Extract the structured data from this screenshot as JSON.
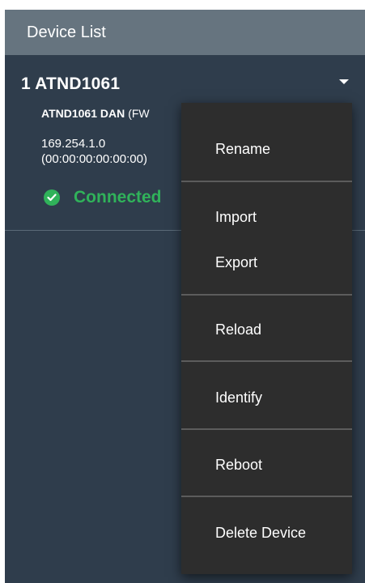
{
  "header": {
    "title": "Device List"
  },
  "device": {
    "index_title": "1 ATND1061",
    "model": "ATND1061 DAN",
    "firmware": "(FW",
    "ip": "169.254.1.0",
    "mac": "(00:00:00:00:00:00)",
    "status": "Connected",
    "status_color": "#30b25a"
  },
  "context_menu": {
    "rename": "Rename",
    "import": "Import",
    "export": "Export",
    "reload": "Reload",
    "identify": "Identify",
    "reboot": "Reboot",
    "delete_device": "Delete Device"
  },
  "icons": {
    "status": "check-circle-icon",
    "expand": "caret-down-icon"
  },
  "colors": {
    "panel_bg": "#2f3d4c",
    "header_bg": "#66747f",
    "menu_bg": "#2d2d2d"
  }
}
